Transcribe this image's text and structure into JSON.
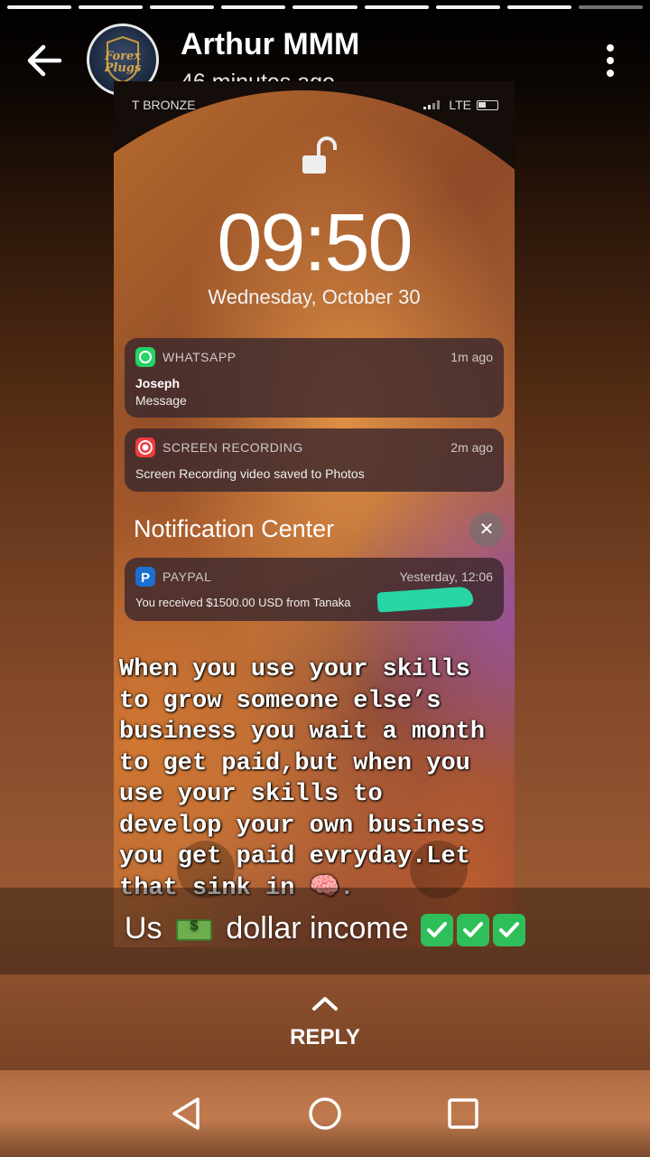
{
  "progress": {
    "total": 9,
    "completed": 8
  },
  "header": {
    "author": "Arthur MMM",
    "time": "46 minutes ago",
    "avatar_text": "Forex Plugs"
  },
  "story": {
    "carrier": "T BRONZE",
    "network": "LTE",
    "clock": "09:50",
    "date": "Wednesday, October 30",
    "notifications": [
      {
        "app": "WHATSAPP",
        "ago": "1m ago",
        "title": "Joseph",
        "body": "Message",
        "color": "#25d366"
      },
      {
        "app": "SCREEN RECORDING",
        "ago": "2m ago",
        "title": "",
        "body": "Screen Recording video saved to Photos",
        "color": "#f23b3b"
      },
      {
        "app": "PAYPAL",
        "ago": "Yesterday, 12:06",
        "title": "",
        "body": "You received $1500.00 USD from Tanaka",
        "color": "#1b6fd1"
      }
    ],
    "notification_center": "Notification Center",
    "close_glyph": "✕",
    "overlay_text": "When you use your skills\nto grow someone else’s\nbusiness you wait a month\nto get paid,but when you\nuse your skills to\ndevelop your own business\nyou get paid evryday.Let\nthat sink in 🧠."
  },
  "caption": {
    "before": "Us",
    "after": "dollar income"
  },
  "reply_label": "REPLY",
  "navbar": {
    "back": "back-nav-icon",
    "home": "home-nav-icon",
    "recents": "recents-nav-icon"
  }
}
